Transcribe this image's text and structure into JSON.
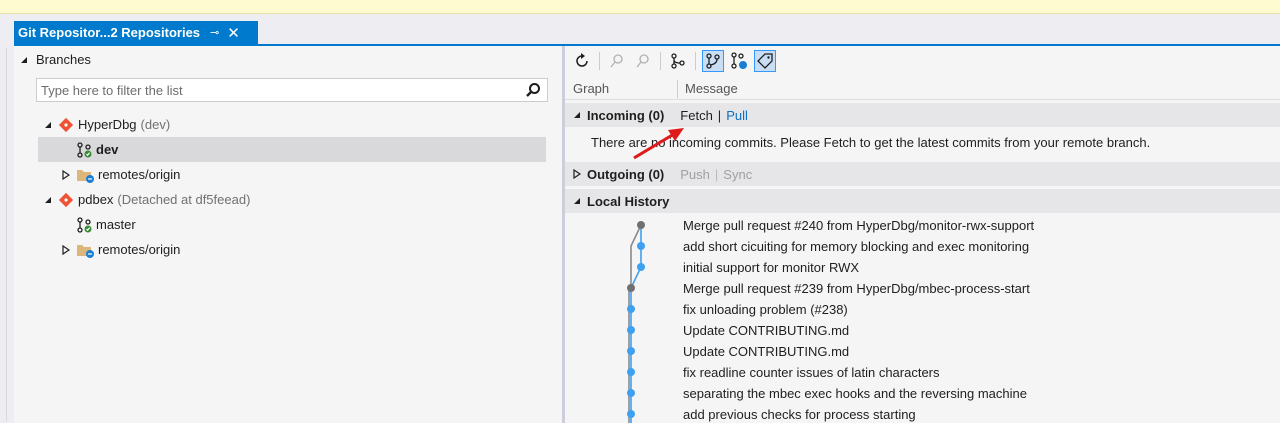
{
  "tab": {
    "title": "Git Repositor...2 Repositories",
    "pin_glyph": "⊸",
    "close_glyph": "✕"
  },
  "left": {
    "section_title": "Branches",
    "filter_placeholder": "Type here to filter the list",
    "tree": [
      {
        "label": "HyperDbg",
        "suffix": "(dev)"
      },
      {
        "label": "dev"
      },
      {
        "label": "remotes/origin"
      },
      {
        "label": "pdbex",
        "suffix": "(Detached at df5feead)"
      },
      {
        "label": "master"
      },
      {
        "label": "remotes/origin"
      }
    ]
  },
  "right": {
    "columns": {
      "graph": "Graph",
      "message": "Message"
    },
    "incoming": {
      "title": "Incoming (0)",
      "fetch": "Fetch",
      "pull": "Pull",
      "message": "There are no incoming commits. Please Fetch to get the latest commits from your remote branch."
    },
    "outgoing": {
      "title": "Outgoing (0)",
      "push": "Push",
      "sync": "Sync"
    },
    "history": {
      "title": "Local History",
      "commits": [
        "Merge pull request #240 from HyperDbg/monitor-rwx-support",
        "add short cicuiting for memory blocking and exec monitoring",
        "initial support for monitor RWX",
        "Merge pull request #239 from HyperDbg/mbec-process-start",
        "fix unloading problem (#238)",
        "Update CONTRIBUTING.md",
        "Update CONTRIBUTING.md",
        "fix readline counter issues of latin characters",
        "separating the mbec exec hooks and the reversing machine",
        "add previous checks for process starting"
      ]
    }
  },
  "colors": {
    "accent": "#007acc",
    "link": "#0e70c0",
    "graph_node": "#3ea0f0",
    "merge_node": "#707070",
    "arrow": "#e0191b"
  }
}
